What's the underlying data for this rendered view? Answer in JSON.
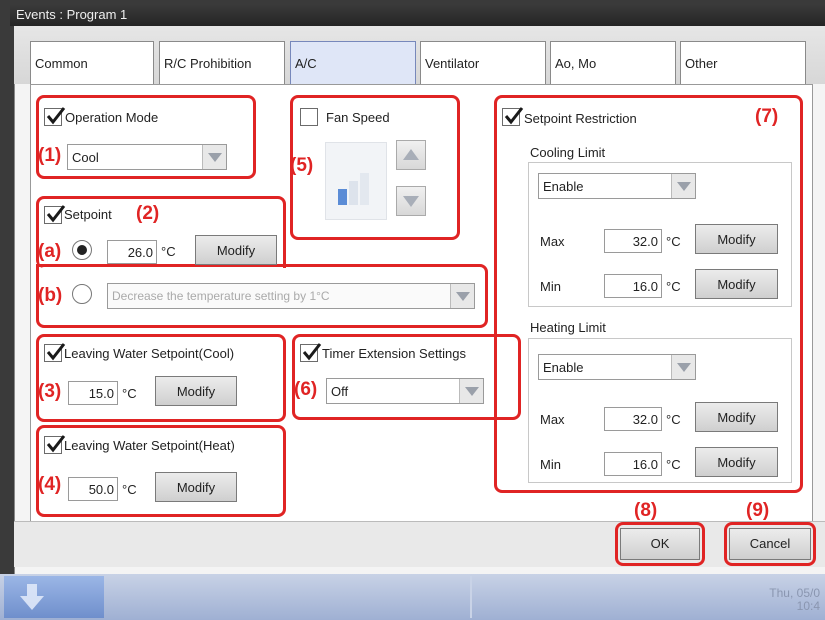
{
  "window": {
    "title": "Events : Program 1"
  },
  "tabs": [
    {
      "label": "Common"
    },
    {
      "label": "R/C Prohibition"
    },
    {
      "label": "A/C"
    },
    {
      "label": "Ventilator"
    },
    {
      "label": "Ao, Mo"
    },
    {
      "label": "Other"
    }
  ],
  "active_tab": "A/C",
  "operation_mode": {
    "label": "Operation Mode",
    "checked": true,
    "value": "Cool",
    "marker": "(1)"
  },
  "setpoint": {
    "label": "Setpoint",
    "checked": true,
    "marker": "(2)",
    "option_a": {
      "marker": "(a)",
      "value": "26.0",
      "unit": "°C",
      "modify": "Modify",
      "selected": true
    },
    "option_b": {
      "marker": "(b)",
      "value": "Decrease the temperature setting by 1°C",
      "selected": false
    }
  },
  "fan_speed": {
    "label": "Fan Speed",
    "checked": false,
    "marker": "(5)"
  },
  "lws_cool": {
    "label": "Leaving Water Setpoint(Cool)",
    "checked": true,
    "marker": "(3)",
    "value": "15.0",
    "unit": "°C",
    "modify": "Modify"
  },
  "lws_heat": {
    "label": "Leaving Water Setpoint(Heat)",
    "checked": true,
    "marker": "(4)",
    "value": "50.0",
    "unit": "°C",
    "modify": "Modify"
  },
  "timer_extension": {
    "label": "Timer Extension Settings",
    "checked": true,
    "marker": "(6)",
    "value": "Off"
  },
  "setpoint_restriction": {
    "label": "Setpoint Restriction",
    "checked": true,
    "marker": "(7)",
    "cooling": {
      "title": "Cooling Limit",
      "mode": "Enable",
      "max_label": "Max",
      "max": "32.0",
      "min_label": "Min",
      "min": "16.0",
      "unit": "°C",
      "modify": "Modify"
    },
    "heating": {
      "title": "Heating Limit",
      "mode": "Enable",
      "max_label": "Max",
      "max": "32.0",
      "min_label": "Min",
      "min": "16.0",
      "unit": "°C",
      "modify": "Modify"
    }
  },
  "footer": {
    "ok": {
      "label": "OK",
      "marker": "(8)"
    },
    "cancel": {
      "label": "Cancel",
      "marker": "(9)"
    }
  },
  "taskbar": {
    "clock_line1": "Thu, 05/0",
    "clock_line2": "10:4"
  },
  "colors": {
    "highlight": "#e02424",
    "active_tab": "#dfe6f7",
    "taskbar": "#9fb0d3"
  }
}
